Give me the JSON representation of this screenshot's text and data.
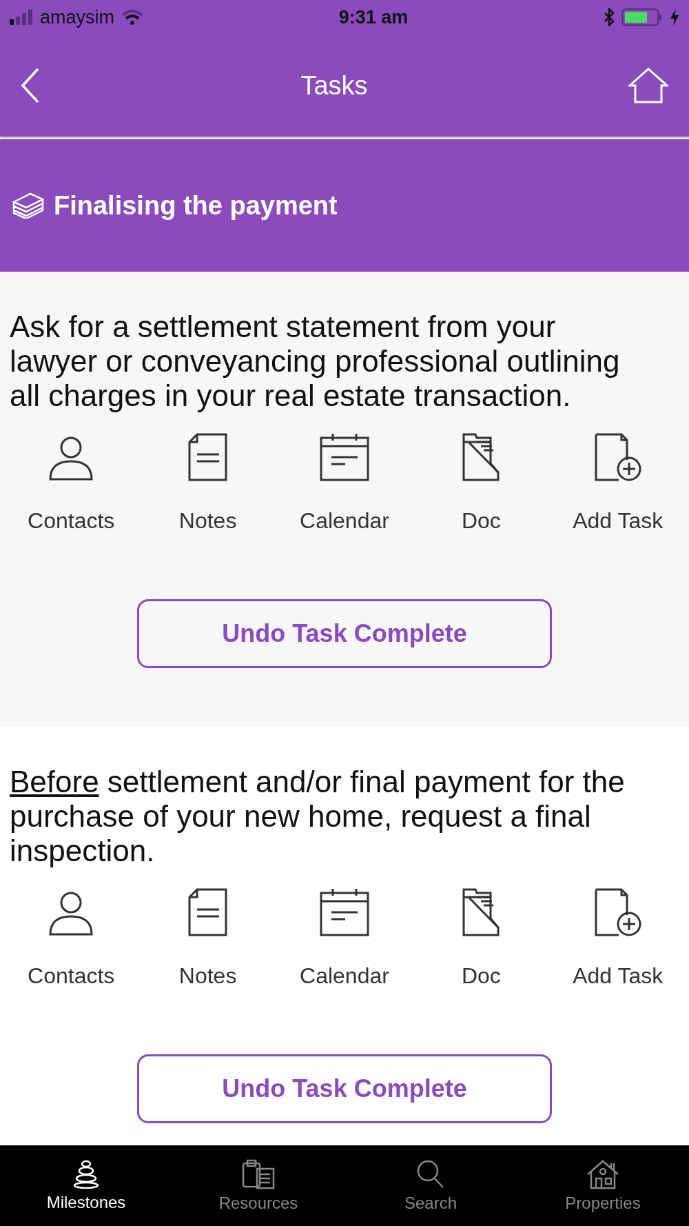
{
  "status_bar": {
    "carrier": "amaysim",
    "time": "9:31 am"
  },
  "nav": {
    "title": "Tasks"
  },
  "section": {
    "title": "Finalising the payment"
  },
  "tasks": [
    {
      "completed": true,
      "text": [
        {
          "t": "Ask for a settlement statement from your lawyer or conveyancing professional outlining all charges in your real estate transaction.",
          "underline": false
        }
      ],
      "actions": [
        {
          "kind": "contacts",
          "label": "Contacts"
        },
        {
          "kind": "notes",
          "label": "Notes"
        },
        {
          "kind": "calendar",
          "label": "Calendar"
        },
        {
          "kind": "doc",
          "label": "Doc"
        },
        {
          "kind": "add",
          "label": "Add Task"
        }
      ],
      "button": "Undo Task Complete"
    },
    {
      "completed": true,
      "text": [
        {
          "t": "Before",
          "underline": true
        },
        {
          "t": " settlement and/or final payment for the purchase of your new home, request a final inspection.",
          "underline": false
        }
      ],
      "actions": [
        {
          "kind": "contacts",
          "label": "Contacts"
        },
        {
          "kind": "notes",
          "label": "Notes"
        },
        {
          "kind": "calendar",
          "label": "Calendar"
        },
        {
          "kind": "doc",
          "label": "Doc"
        },
        {
          "kind": "add",
          "label": "Add Task"
        }
      ],
      "button": "Undo Task Complete"
    }
  ],
  "tab_bar": [
    {
      "kind": "milestones",
      "label": "Milestones",
      "selected": true
    },
    {
      "kind": "resources",
      "label": "Resources",
      "selected": false
    },
    {
      "kind": "search",
      "label": "Search",
      "selected": false
    },
    {
      "kind": "properties",
      "label": "Properties",
      "selected": false
    }
  ]
}
